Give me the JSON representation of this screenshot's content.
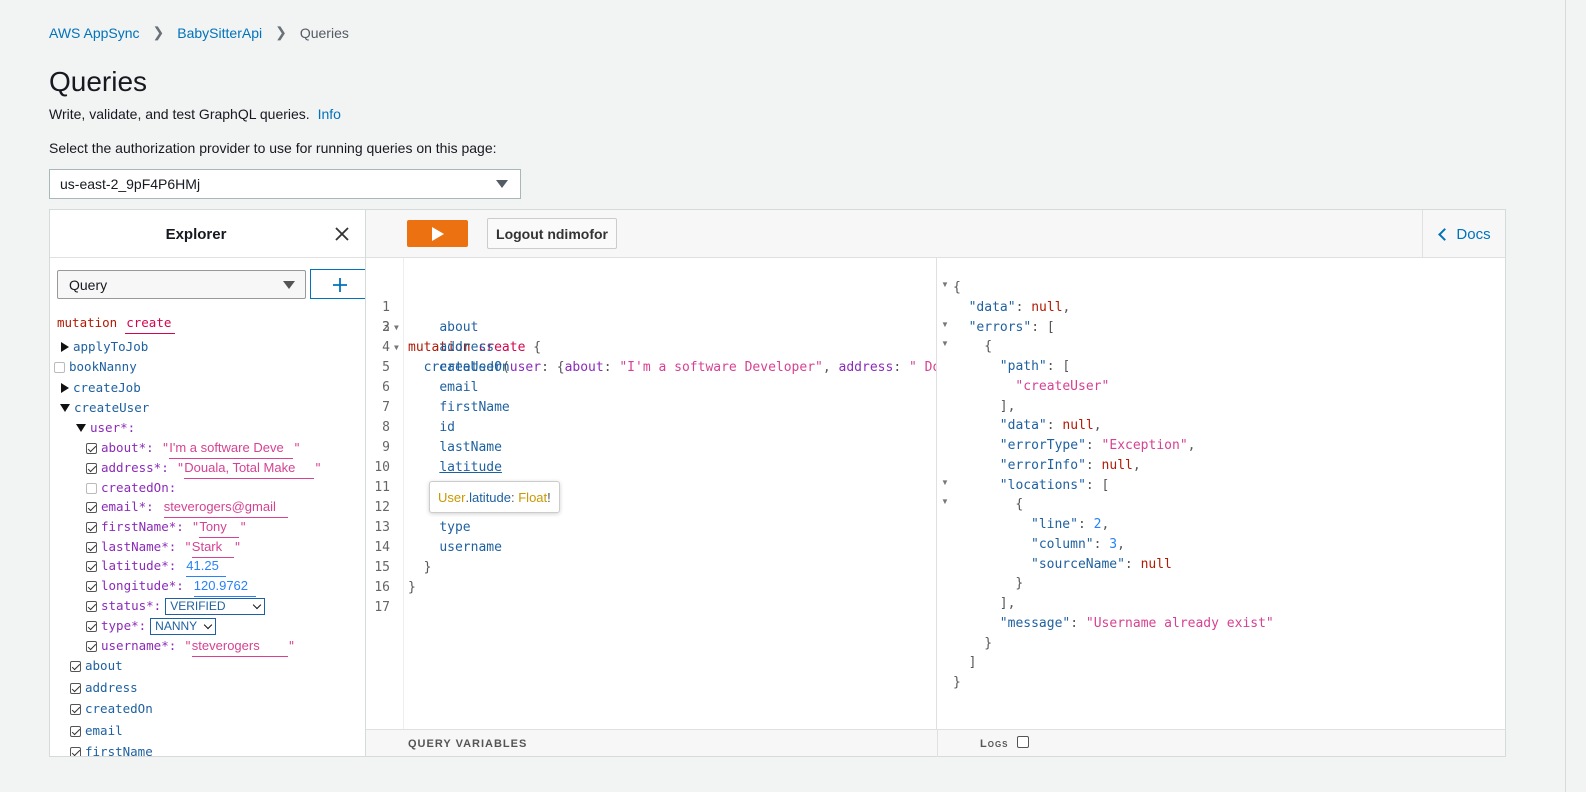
{
  "breadcrumb": {
    "root": "AWS AppSync",
    "api": "BabySitterApi",
    "current": "Queries"
  },
  "header": {
    "title": "Queries",
    "description": "Write, validate, and test GraphQL queries.",
    "info_link": "Info",
    "auth_label": "Select the authorization provider to use for running queries on this page:",
    "auth_provider": "us-east-2_9pF4P6HMj"
  },
  "explorer": {
    "title": "Explorer",
    "operation_type": "Query",
    "mutation_keyword": "mutation",
    "operation_name": "create",
    "fields": {
      "applyToJob": "applyToJob",
      "bookNanny": "bookNanny",
      "createJob": "createJob",
      "createUser": "createUser",
      "user": "user*:"
    },
    "args": {
      "about": {
        "label": "about*:",
        "value": "I'm a software Deve"
      },
      "address": {
        "label": "address*:",
        "value": " Douala, Total Make"
      },
      "createdOn": {
        "label": "createdOn:"
      },
      "email": {
        "label": "email*:",
        "value": "steverogers@gmail"
      },
      "firstName": {
        "label": "firstName*:",
        "value": "Tony "
      },
      "lastName": {
        "label": "lastName*:",
        "value": "Stark "
      },
      "latitude": {
        "label": "latitude*:",
        "value": "41.25"
      },
      "longitude": {
        "label": "longitude*:",
        "value": "120.9762"
      },
      "status": {
        "label": "status*:",
        "value": "VERIFIED"
      },
      "type": {
        "label": "type*:",
        "value": "NANNY"
      },
      "username": {
        "label": "username*:",
        "value": "steverogers "
      }
    },
    "selected_fields": [
      "about",
      "address",
      "createdOn",
      "email",
      "firstName"
    ]
  },
  "toolbar": {
    "logout_label": "Logout ndimofor",
    "docs_label": "Docs"
  },
  "editor": {
    "line_numbers": [
      "1",
      "2",
      "3",
      "4",
      "5",
      "6",
      "7",
      "8",
      "9",
      "10",
      "11",
      "12",
      "13",
      "14",
      "15",
      "16",
      "17"
    ],
    "mutation_kw": "mutation",
    "op_name": "create",
    "brace_open": "{",
    "brace_close": "}",
    "createUser": "createUser",
    "user_arg": "user",
    "about_arg": "about",
    "about_val": "\"I'm a software Developer\"",
    "address_arg": "address",
    "address_val": "\" Dou",
    "fields": [
      "about",
      "address",
      "createdOn",
      "email",
      "firstName",
      "id",
      "lastName",
      "latitude",
      "type",
      "username"
    ],
    "tooltip": {
      "type": "User",
      "field": "latitude",
      "field_type": "Float"
    }
  },
  "result": {
    "lines": [
      "{",
      "\"data\": null,",
      "\"errors\": [",
      "{",
      "\"path\": [",
      "\"createUser\"",
      "],",
      "\"data\": null,",
      "\"errorType\": \"Exception\",",
      "\"errorInfo\": null,",
      "\"locations\": [",
      "{",
      "\"line\": 2,",
      "\"column\": 3,",
      "\"sourceName\": null",
      "}",
      "],",
      "\"message\": \"Username already exist\"",
      "}",
      "]",
      "}"
    ]
  },
  "bottom": {
    "query_variables": "QUERY VARIABLES",
    "logs": "Logs"
  },
  "colors": {
    "accent": "#ec7211",
    "link": "#0073bb"
  }
}
